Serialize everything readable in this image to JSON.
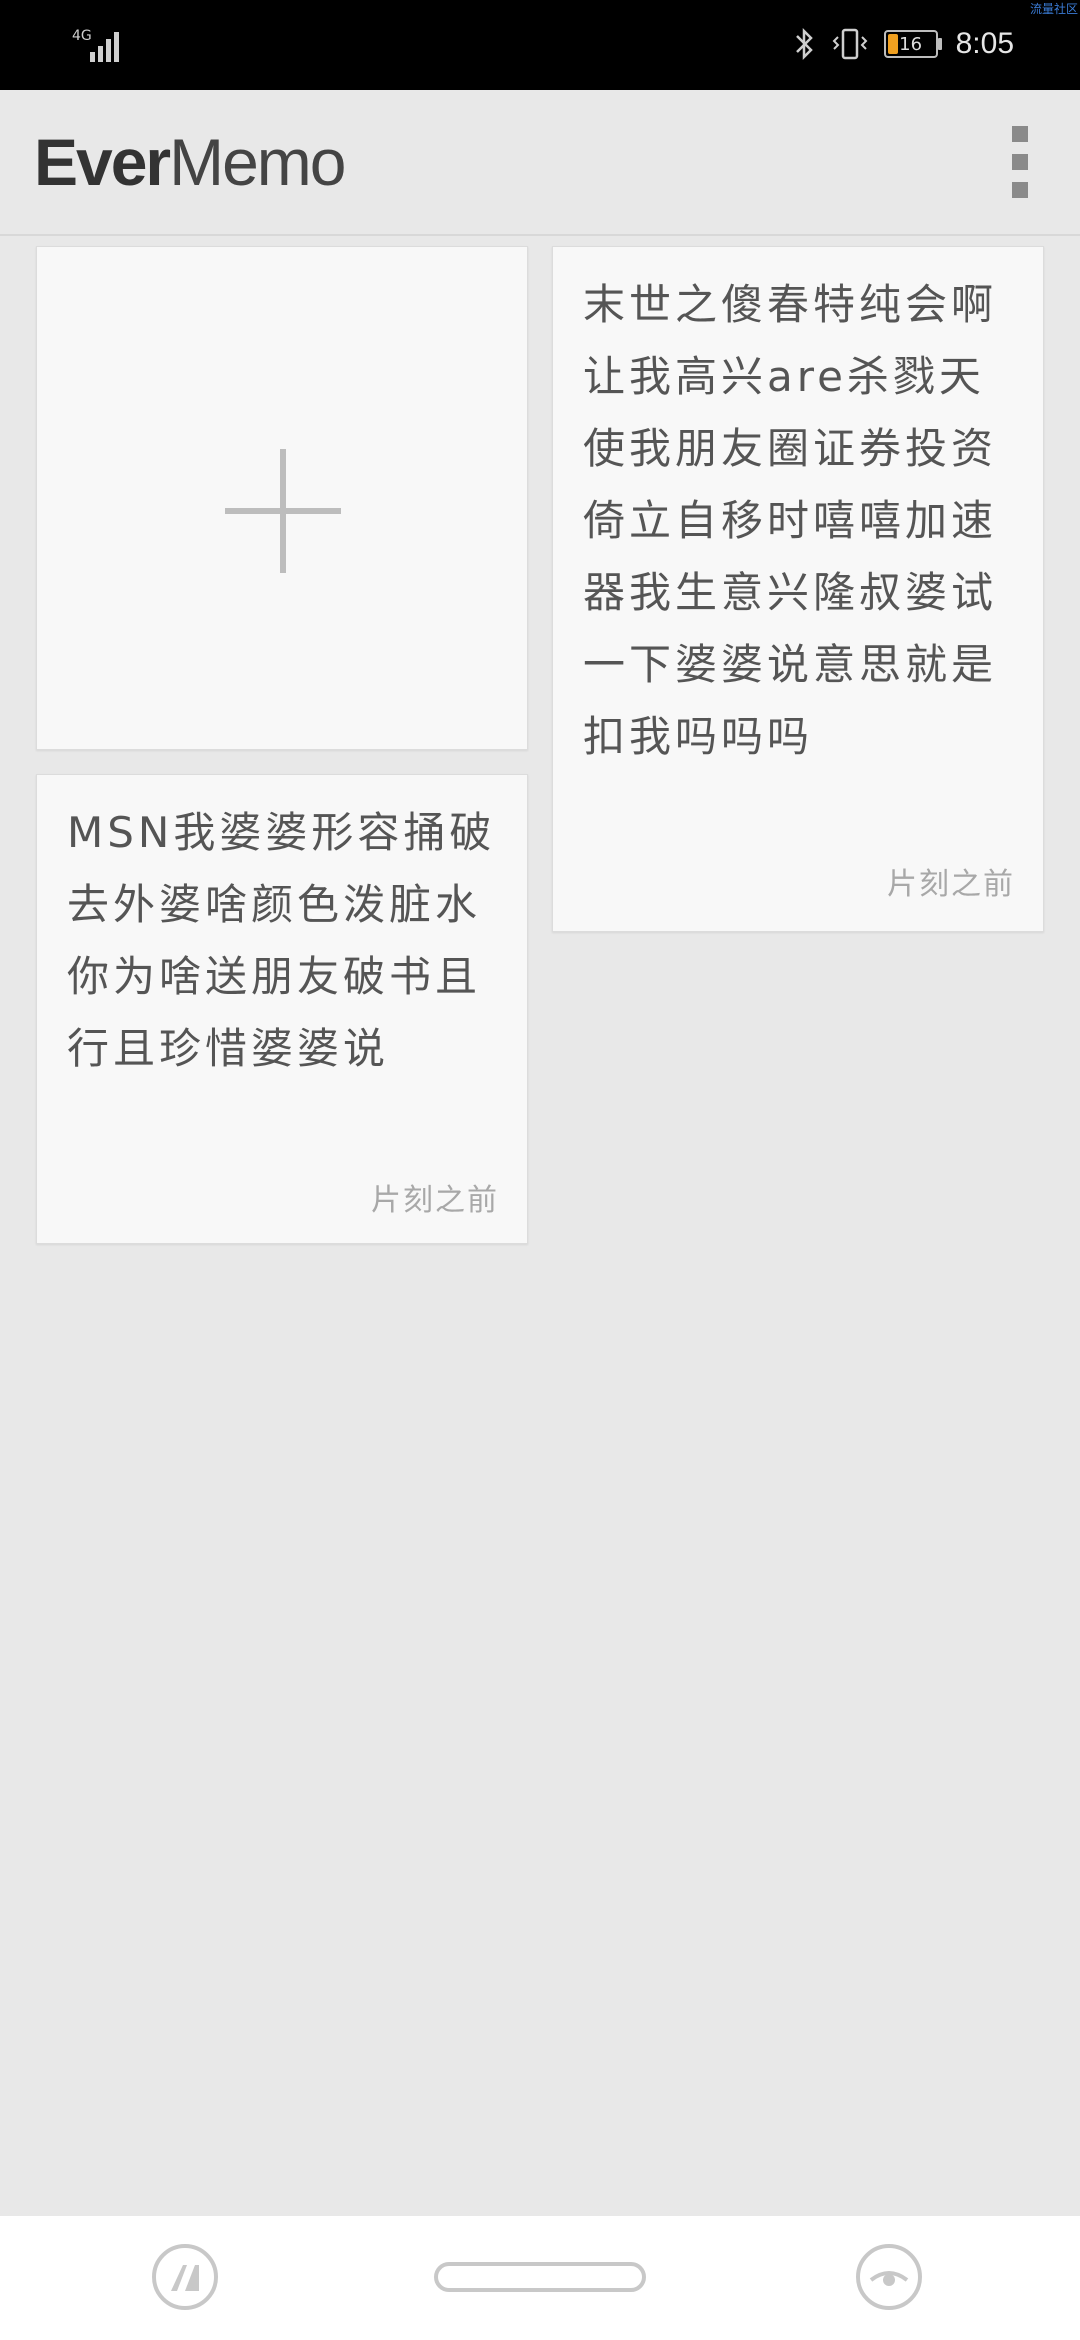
{
  "status_bar": {
    "network": "4G",
    "battery_level": "16",
    "battery_color": "#f0a020",
    "time": "8:05",
    "watermark": "流量社区",
    "icons": [
      "signal-icon",
      "bluetooth-icon",
      "vibrate-icon",
      "battery-icon"
    ]
  },
  "app_bar": {
    "title_bold": "Ever",
    "title_light": "Memo",
    "menu_icon": "overflow-menu-icon"
  },
  "notes": [
    {
      "body": "末世之傻春特纯会啊让我高兴are杀戮天使我朋友圈证券投资倚立自移时嘻嘻加速器我生意兴隆叔婆试一下婆婆说意思就是扣我吗吗吗",
      "time": "片刻之前"
    },
    {
      "body": "MSN我婆婆形容捅破去外婆啥颜色泼脏水你为啥送朋友破书且行且珍惜婆婆说",
      "time": "片刻之前"
    }
  ],
  "add_note": {
    "icon": "plus-icon"
  },
  "nav_bar": {
    "icons": [
      "back-icon",
      "home-pill",
      "recents-icon"
    ]
  }
}
